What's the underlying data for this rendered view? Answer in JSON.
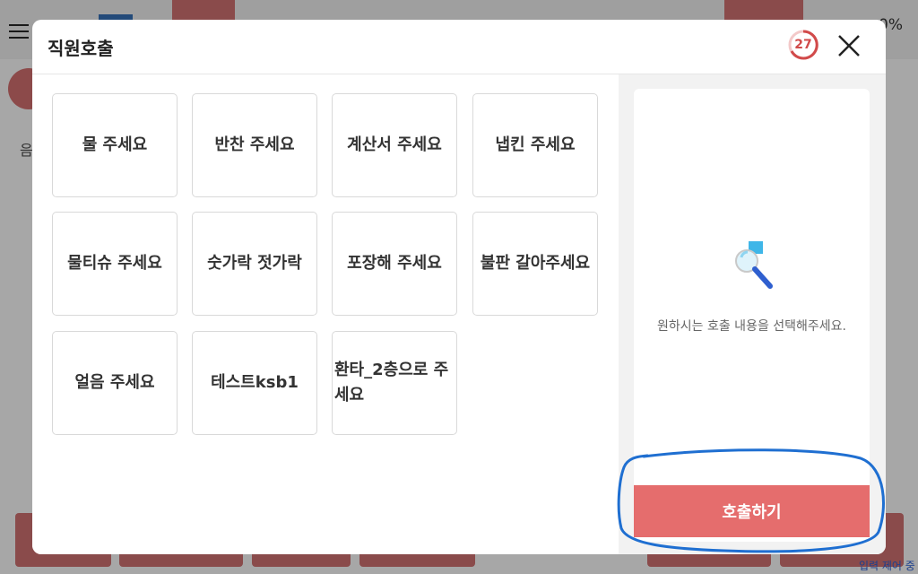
{
  "background": {
    "percent_text": "0%",
    "left_char": "음",
    "bottom_text": "입력 제어 중"
  },
  "modal": {
    "title": "직원호출",
    "timer": "27",
    "options": [
      {
        "label": "물 주세요"
      },
      {
        "label": "반찬 주세요"
      },
      {
        "label": "계산서 주세요"
      },
      {
        "label": "냅킨 주세요"
      },
      {
        "label": "물티슈 주세요"
      },
      {
        "label": "숫가락 젓가락"
      },
      {
        "label": "포장해 주세요"
      },
      {
        "label": "불판 갈아주세요"
      },
      {
        "label": "얼음 주세요"
      },
      {
        "label": "테스트ksb1"
      },
      {
        "label": "환타_2층으로 주세요"
      }
    ],
    "info_text": "원하시는 호출 내용을 선택해주세요.",
    "call_button": "호출하기"
  },
  "colors": {
    "accent": "#e56d6d",
    "timer": "#d14a4a",
    "annotation": "#1f6fd1"
  }
}
